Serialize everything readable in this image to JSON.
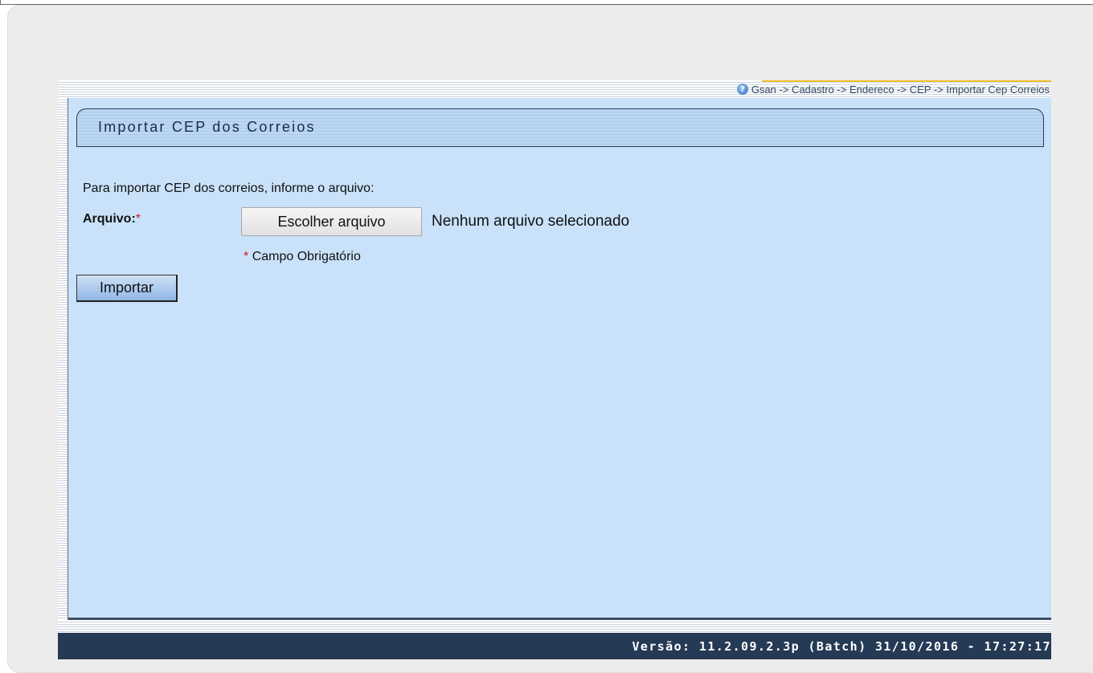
{
  "breadcrumb": {
    "icon": "help-icon",
    "text": "Gsan -> Cadastro -> Endereco -> CEP -> Importar Cep Correios"
  },
  "page": {
    "title": "Importar CEP dos Correios",
    "intro": "Para importar CEP dos correios, informe o arquivo:"
  },
  "form": {
    "file_label": "Arquivo:",
    "required_marker": "*",
    "file_button_label": "Escolher arquivo",
    "file_status": "Nenhum arquivo selecionado",
    "required_note_marker": "*",
    "required_note": "Campo Obrigatório",
    "submit_label": "Importar"
  },
  "footer": {
    "version": "Versão: 11.2.09.2.3p (Batch) 31/10/2016 - 17:27:17"
  },
  "colors": {
    "panel_background": "#c9e2fa",
    "footer_background": "#253a55",
    "required_star": "#cc2222",
    "accent": "#f0c12b"
  }
}
